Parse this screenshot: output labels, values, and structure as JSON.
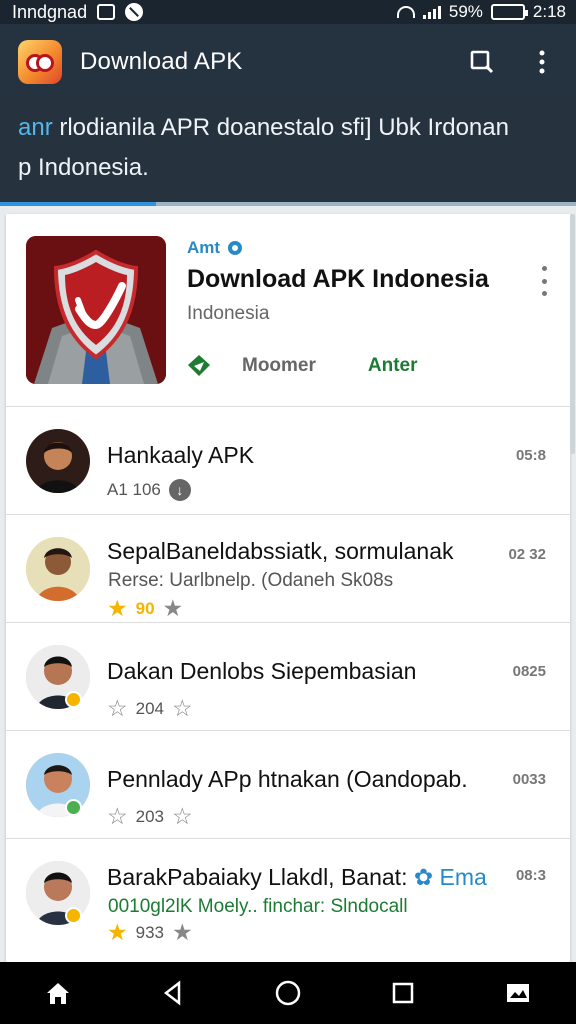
{
  "status_bar": {
    "left_text": "Inndgnad",
    "battery_text": "59%",
    "time": "2:18"
  },
  "app_bar": {
    "title": "Download APK"
  },
  "banner": {
    "accent_text": "anr",
    "line1_rest": " rlodianila APR doanestalo sfi]   Ubk   Irdonan",
    "line2": "p Indonesia.",
    "progress_value": 0.27
  },
  "featured": {
    "label": "Amt",
    "title": "Download APK Indonesia",
    "subtitle": "Indonesia",
    "secondary_action": "Moomer",
    "primary_action": "Anter"
  },
  "items": [
    {
      "title": "Hankaaly APK",
      "meta": "A1 106",
      "time": "05:8"
    },
    {
      "title": "SepalBaneldabssiatk, sormulanak",
      "subtitle": "Rerse: Uarlbnelp. (Odaneh Sk08s",
      "meta": "90",
      "time": "02 32"
    },
    {
      "title": "Dakan Denlobs Siepembasian",
      "meta": "204",
      "time": "0825"
    },
    {
      "title": "Pennlady APp htnakan (Oandopab.",
      "meta": "203",
      "time": "0033"
    },
    {
      "title": "BarakPabaiaky Llakdl,  Banat:",
      "title_accent": "Ema",
      "subtitle": "0010gl2lK Moely.. finchar: Slndocall",
      "meta": "933",
      "time": "08:3"
    }
  ],
  "colors": {
    "app_bar": "#253341",
    "accent_blue": "#2889c8",
    "accent_green": "#1d7b34",
    "star": "#f5b400"
  },
  "icons": {
    "app": "app-logo-icon",
    "search": "search-icon",
    "menu": "more-vert-icon",
    "home": "home-icon",
    "back": "back-icon",
    "recent": "recent-apps-icon",
    "gallery": "gallery-icon"
  }
}
